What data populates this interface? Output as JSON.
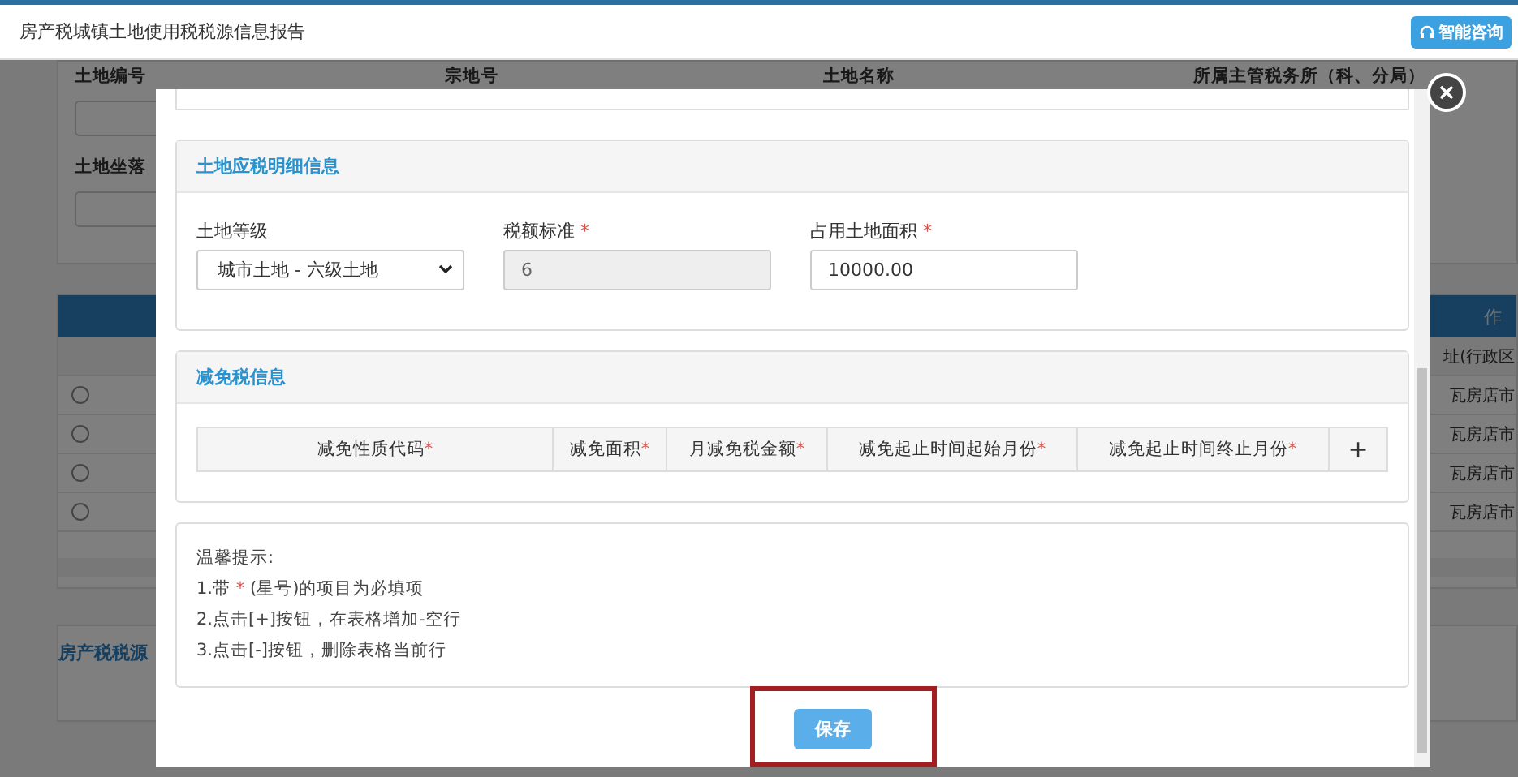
{
  "window": {
    "title": "房产税城镇土地使用税税源信息报告"
  },
  "header_button": {
    "label": "智能咨询"
  },
  "required_mark": "*",
  "background": {
    "columns": [
      "土地编号",
      "宗地号",
      "土地名称",
      "所属主管税务所（科、分局）"
    ],
    "location_label": "土地坐落",
    "table_tab": "作",
    "table_header": "址(行政区",
    "rows": [
      {
        "selected": false,
        "region": "瓦房店市"
      },
      {
        "selected": false,
        "region": "瓦房店市"
      },
      {
        "selected": false,
        "region": "瓦房店市"
      },
      {
        "selected": false,
        "region": "瓦房店市"
      }
    ],
    "section_title": "房产税税源"
  },
  "modal": {
    "detail_card": {
      "title": "土地应税明细信息",
      "fields": [
        {
          "kind": "select",
          "label": "土地等级",
          "required": false,
          "disabled": false,
          "value": "城市土地 - 六级土地"
        },
        {
          "kind": "input",
          "label": "税额标准",
          "required": true,
          "disabled": true,
          "value": "6"
        },
        {
          "kind": "input",
          "label": "占用土地面积",
          "required": true,
          "disabled": false,
          "value": "10000.00"
        }
      ]
    },
    "relief_card": {
      "title": "减免税信息",
      "columns": [
        {
          "label": "减免性质代码",
          "required": true
        },
        {
          "label": "减免面积",
          "required": true
        },
        {
          "label": "月减免税金额",
          "required": true
        },
        {
          "label": "减免起止时间起始月份",
          "required": true
        },
        {
          "label": "减免起止时间终止月份",
          "required": true
        }
      ],
      "add_button": "+"
    },
    "tips": {
      "title": "温馨提示:",
      "lines": [
        {
          "text": "1.带",
          "mark": "*",
          "rest": "(星号)的项目为必填项"
        },
        {
          "text": "2.点击[+]按钮，在表格增加-空行"
        },
        {
          "text": "3.点击[-]按钮，删除表格当前行"
        }
      ]
    },
    "save_button": "保存",
    "save_highlighted": true
  }
}
